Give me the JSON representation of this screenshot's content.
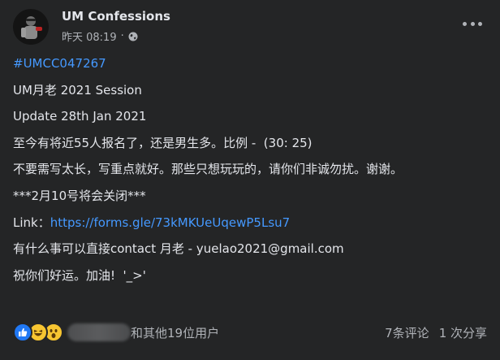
{
  "post": {
    "page_name": "UM Confessions",
    "time": "昨天 08:19",
    "separator": "·",
    "lines": [
      "UM月老 2021 Session",
      "Update 28th Jan 2021",
      "至今有将近55人报名了，还是男生多。比例 -  (30: 25)",
      "不要需写太长，写重点就好。那些只想玩玩的，请你们非诚勿扰。谢谢。",
      "***2月10号将会关闭***"
    ],
    "hashtag": "#UMCC047267",
    "link_label": "Link：",
    "link_url": "https://forms.gle/73kMKUeUqewP5Lsu7",
    "contact_line": "有什么事可以直接contact 月老 - yuelao2021@gmail.com",
    "closing_line": "祝你们好运。加油!  '_>'"
  },
  "footer": {
    "reactions_others": "和其他19位用户",
    "comments": "7条评论",
    "shares": "1 次分享"
  },
  "colors": {
    "background": "#242526",
    "text": "#e4e6eb",
    "secondary": "#b0b3b8",
    "link": "#4599ff",
    "like": "#2078f4",
    "haha": "#f7c531"
  },
  "icons": [
    "avatar",
    "globe-icon",
    "more-icon",
    "like-icon",
    "haha-icon",
    "wow-icon"
  ]
}
